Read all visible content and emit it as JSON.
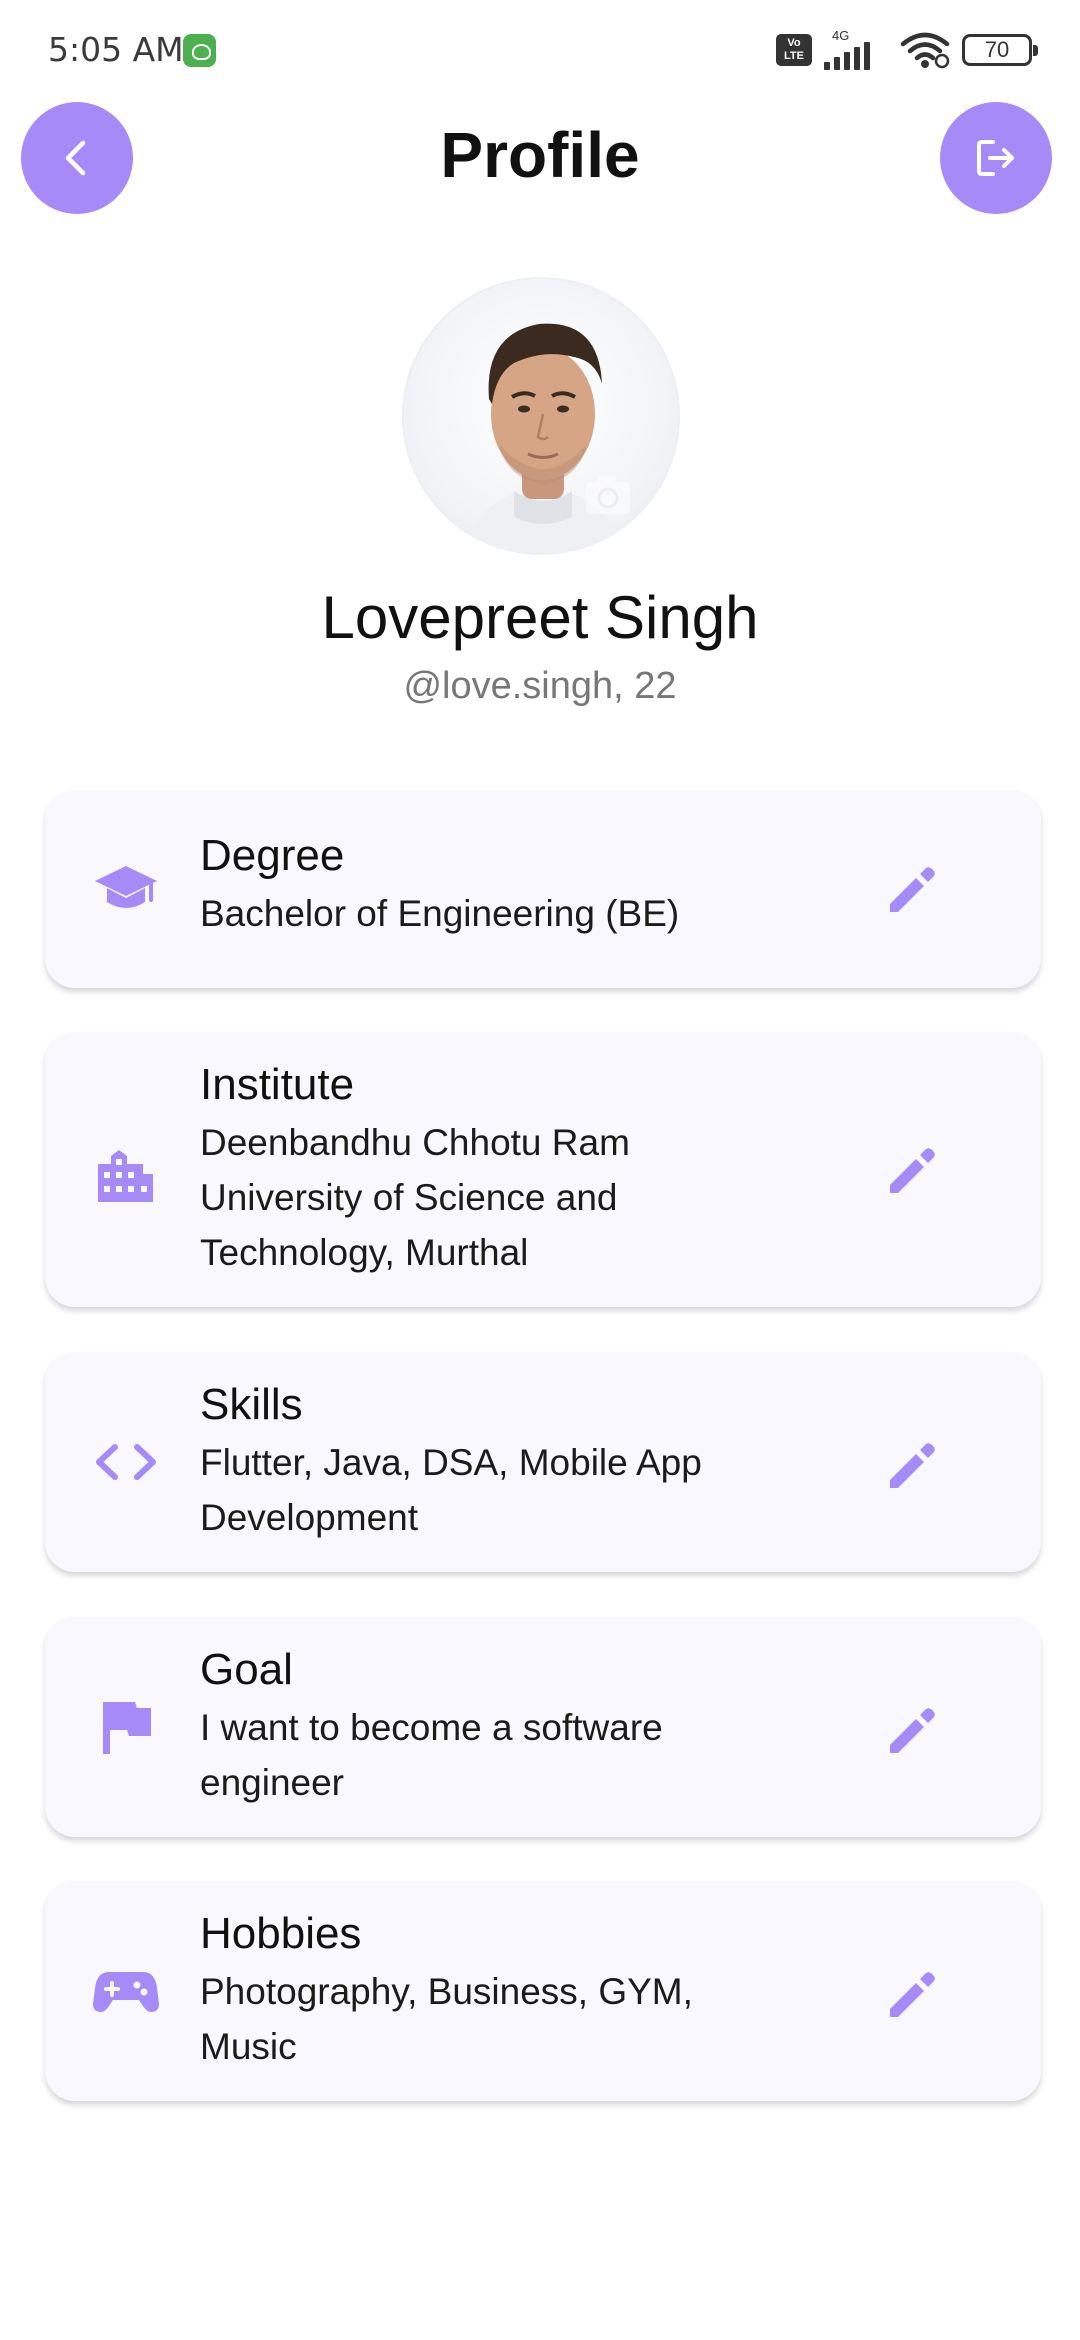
{
  "status_bar": {
    "time": "5:05 AM",
    "network": "4G",
    "volte": "Vo LTE",
    "battery": "70"
  },
  "header": {
    "title": "Profile",
    "back_icon": "chevron-left-icon",
    "logout_icon": "logout-icon"
  },
  "profile": {
    "name": "Lovepreet Singh",
    "handle": "@love.singh, 22"
  },
  "cards": [
    {
      "icon": "graduation-cap-icon",
      "title": "Degree",
      "value": "Bachelor of Engineering (BE)"
    },
    {
      "icon": "building-icon",
      "title": "Institute",
      "value": "Deenbandhu Chhotu Ram University of Science and Technology, Murthal"
    },
    {
      "icon": "code-icon",
      "title": "Skills",
      "value": "Flutter, Java, DSA, Mobile App Development"
    },
    {
      "icon": "flag-icon",
      "title": "Goal",
      "value": "I want to become a software engineer"
    },
    {
      "icon": "gamepad-icon",
      "title": "Hobbies",
      "value": "Photography, Business, GYM, Music"
    }
  ],
  "colors": {
    "accent": "#a68af8",
    "card_bg": "#f9f8fe",
    "text_primary": "#111111",
    "text_secondary": "#777777"
  }
}
